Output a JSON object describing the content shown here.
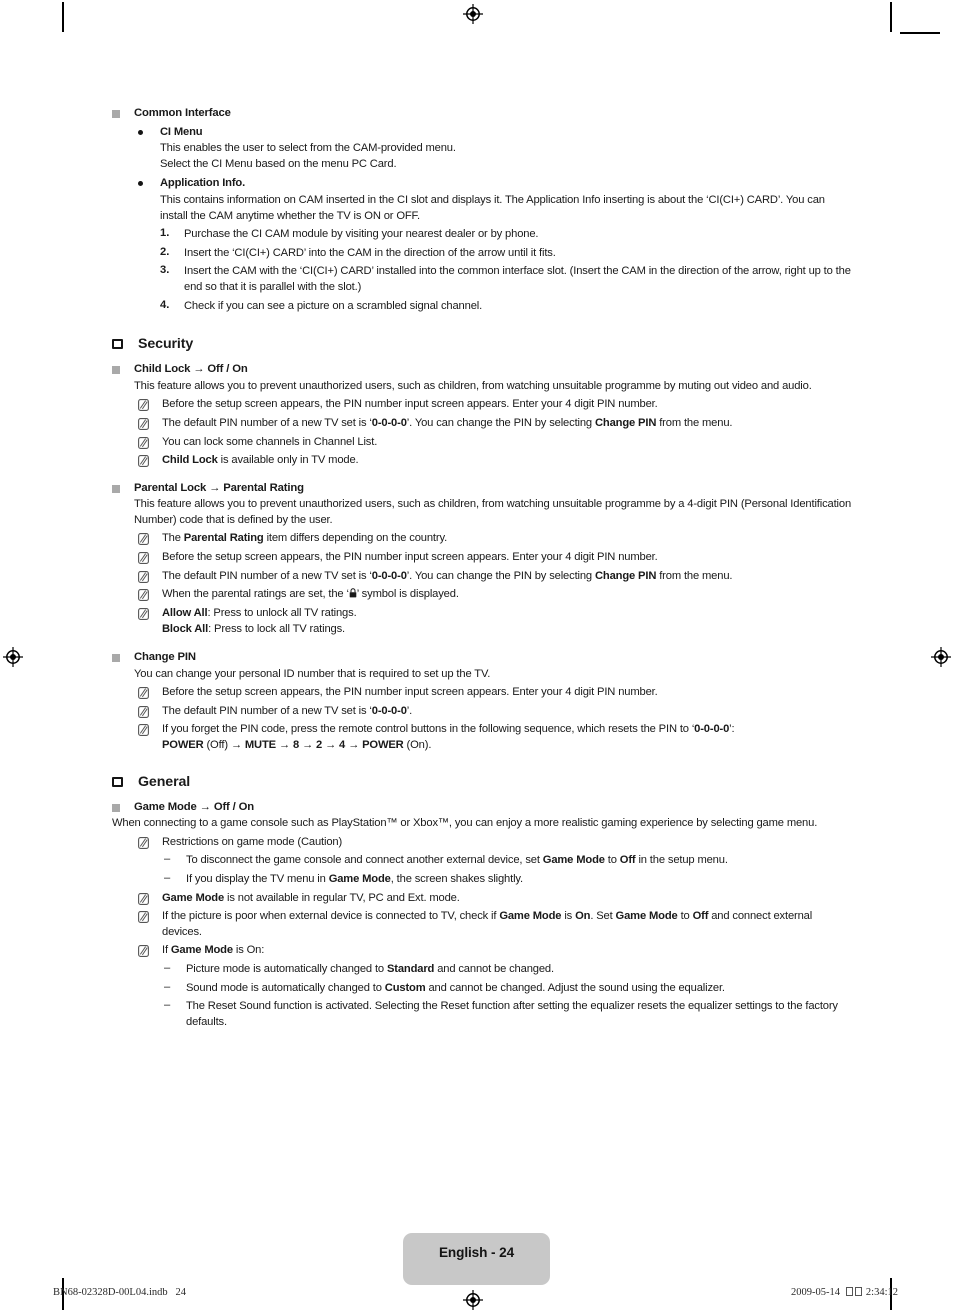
{
  "page": {
    "footer_badge": "English - 24",
    "print_left": "BN68-02328D-00L04.indb   24",
    "print_date": "2009-05-14",
    "print_time": "2:34:12"
  },
  "icons": {
    "square_bullet": "gray-square-bullet",
    "section_bullet": "outlined-square-bullet",
    "round_bullet": "round-bullet",
    "note": "note-icon",
    "dash": "–",
    "registration": "registration-crosshair-mark",
    "lock": "padlock-symbol"
  },
  "common_interface": {
    "heading": "Common Interface",
    "ci_menu": {
      "title": "CI Menu",
      "line1": "This enables the user to select from the CAM-provided menu.",
      "line2": "Select the CI Menu based on the menu PC Card."
    },
    "application_info": {
      "title": "Application Info.",
      "body": "This contains information on CAM inserted in the CI slot and displays it. The Application Info inserting is about the ‘CI(CI+) CARD’. You can install the CAM anytime whether the TV is ON or OFF.",
      "steps": [
        {
          "num": "1.",
          "text": "Purchase the CI CAM module by visiting your nearest dealer or by phone."
        },
        {
          "num": "2.",
          "text": "Insert the ‘CI(CI+) CARD’ into the CAM in the direction of the arrow until it fits."
        },
        {
          "num": "3.",
          "text": "Insert the CAM with the ‘CI(CI+) CARD’ installed into the common interface slot. (Insert the CAM in the direction of the arrow, right up to the end so that it is parallel with the slot.)"
        },
        {
          "num": "4.",
          "text": "Check if you can see a picture on a scrambled signal channel."
        }
      ]
    }
  },
  "security": {
    "heading": "Security",
    "child_lock": {
      "title_plain": "Child Lock ",
      "title_arrow": "→ ",
      "title_value": "Off / On",
      "body": "This feature allows you to prevent unauthorized users, such as children, from watching unsuitable programme by muting out video and audio.",
      "notes": [
        "Before the setup screen appears, the PIN number input screen appears. Enter your 4 digit PIN number.",
        "The default PIN number of a new TV set is ‘0-0-0-0’. You can change the PIN by selecting Change PIN from the menu.",
        "You can lock some channels in Channel List.",
        "Child Lock is available only in TV mode."
      ]
    },
    "parental_lock": {
      "title_plain": "Parental Lock ",
      "title_arrow": "→ ",
      "title_value": "Parental Rating",
      "body": "This feature allows you to prevent unauthorized users, such as children, from watching unsuitable programme by a 4-digit PIN (Personal Identification Number) code that is defined by the user.",
      "notes": [
        "The Parental Rating item differs depending on the country.",
        "Before the setup screen appears, the PIN number input screen appears. Enter your 4 digit PIN number.",
        "The default PIN number of a new TV set is ‘0-0-0-0’. You can change the PIN by selecting Change PIN from the menu.",
        "When the parental ratings are set, the ‘\u0001’ symbol is displayed.",
        "Allow All: Press to unlock all TV ratings."
      ],
      "block_all": "Block All: Press to lock all TV ratings."
    },
    "change_pin": {
      "title": "Change PIN",
      "body": "You can change your personal ID number that is required to set up the TV.",
      "notes": [
        "Before the setup screen appears, the PIN number input screen appears. Enter your 4 digit PIN number.",
        "The default PIN number of a new TV set is ‘0-0-0-0’.",
        "If you forget the PIN code, press the remote control buttons in the following sequence, which resets the PIN to ‘0-0-0-0’: POWER (Off) → MUTE → 8 → 2 → 4 → POWER (On)."
      ]
    }
  },
  "general": {
    "heading": "General",
    "game_mode": {
      "title_plain": "Game Mode ",
      "title_arrow": "→ ",
      "title_value": "Off / On",
      "body": "When connecting to a game console such as PlayStation™ or Xbox™, you can enjoy a more realistic gaming experience by selecting game menu.",
      "restrictions_label": "Restrictions on game mode (Caution)",
      "restrictions": [
        "To disconnect the game console and connect another external device, set Game Mode to Off in the setup menu.",
        "If you display the TV menu in Game Mode, the screen shakes slightly."
      ],
      "note_not_available": "Game Mode is not available in regular TV, PC and Ext. mode.",
      "note_poor_picture": "If the picture is poor when external device is connected to TV, check if Game Mode is On. Set Game Mode to Off and connect external devices.",
      "note_if_on": "If Game Mode is On:",
      "if_on_items": [
        "Picture mode is automatically changed to Standard and cannot be changed.",
        "Sound mode is automatically changed to Custom and cannot be changed. Adjust the sound using the equalizer.",
        "The Reset Sound function is activated. Selecting the Reset function after setting the equalizer resets the equalizer settings to the factory defaults."
      ]
    }
  }
}
